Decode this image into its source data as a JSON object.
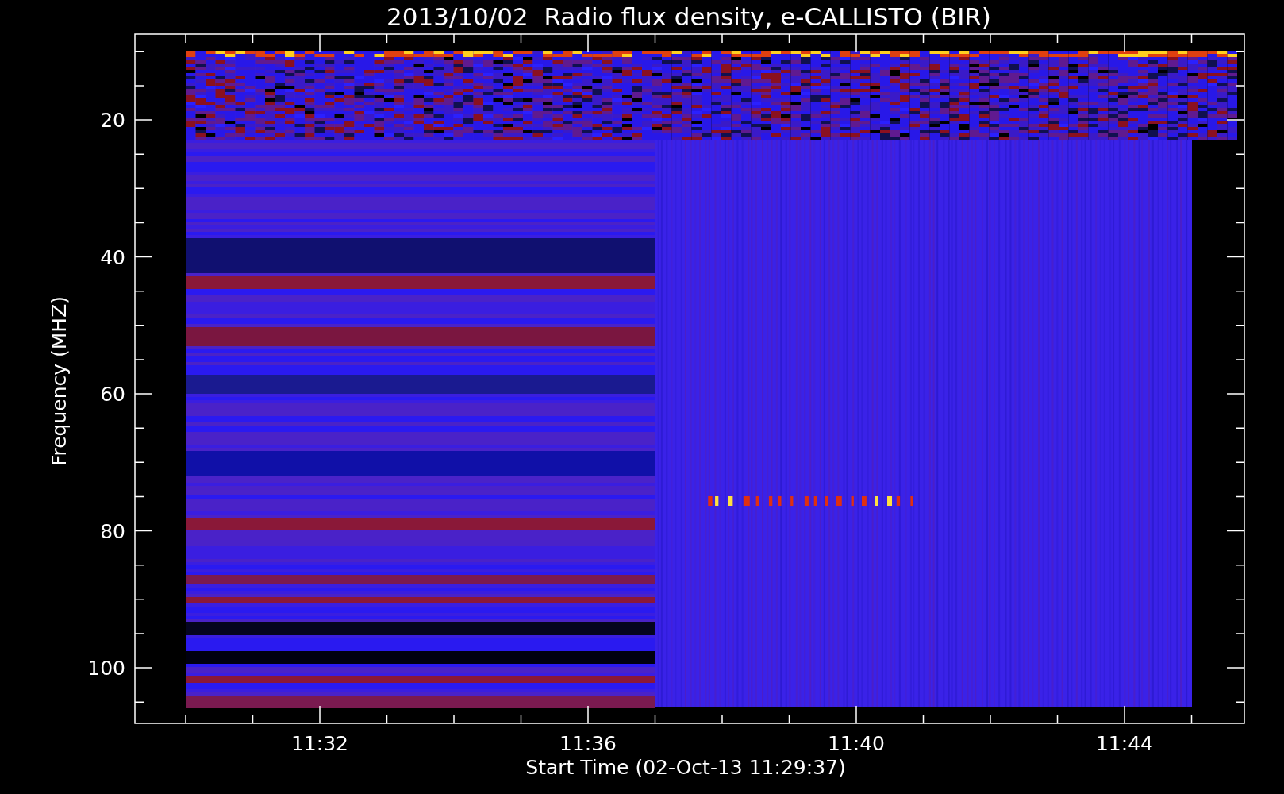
{
  "title": "2013/10/02  Radio flux density, e-CALLISTO (BIR)",
  "y_axis": {
    "label": "Frequency (MHZ)",
    "ticks": [
      "20",
      "40",
      "60",
      "80",
      "100"
    ]
  },
  "x_axis": {
    "label": "Start Time (02-Oct-13 11:29:37)",
    "ticks": [
      "11:32",
      "11:36",
      "11:40",
      "11:44"
    ]
  }
}
